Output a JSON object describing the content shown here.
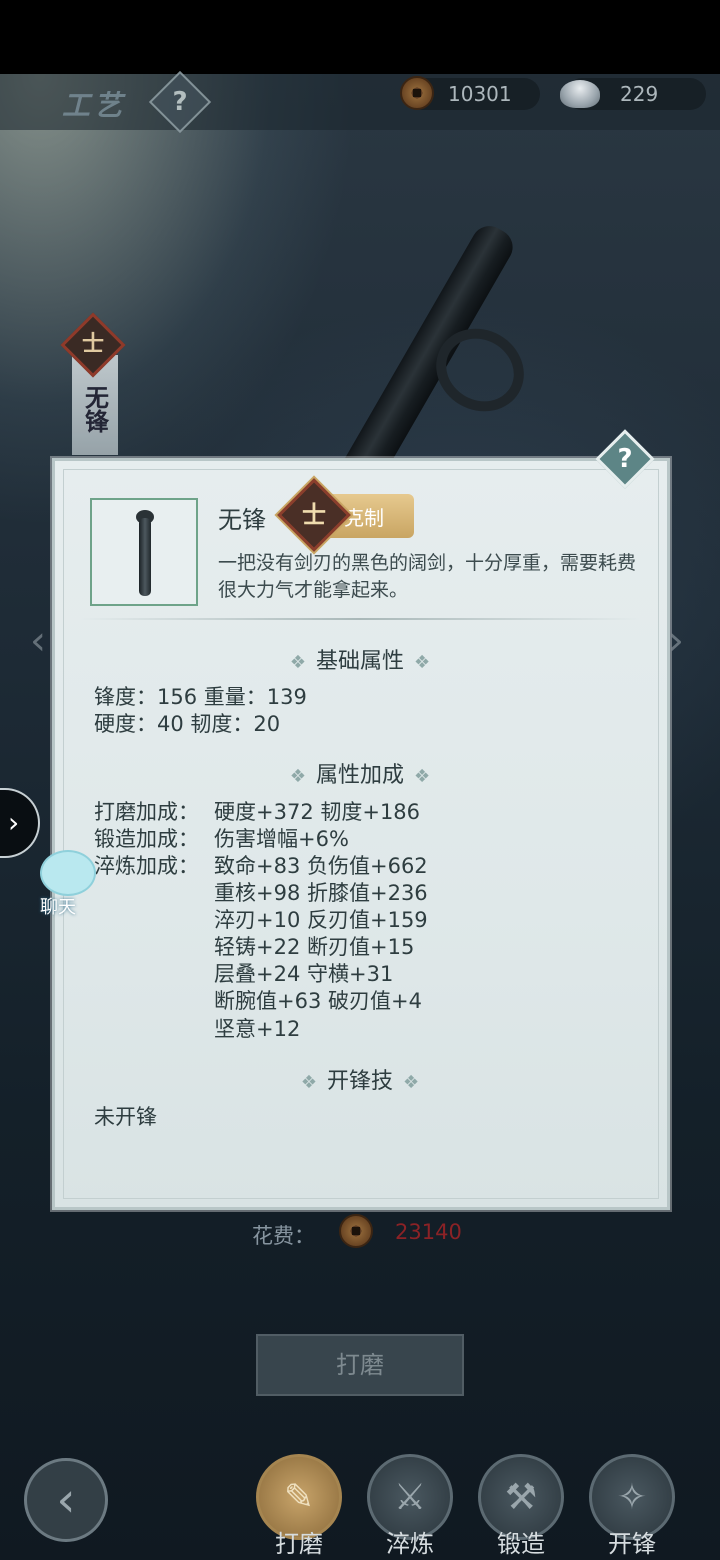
{
  "header": {
    "title": "工艺",
    "help_symbol": "?",
    "copper_amount": "10301",
    "silver_amount": "229"
  },
  "side_tag": {
    "label": "无锋",
    "emblem": "士"
  },
  "item": {
    "name": "无锋",
    "emblem": "士",
    "counter_label": "克制",
    "description": "一把没有剑刃的黑色的阔剑，十分厚重，需要耗费很大力气才能拿起来。"
  },
  "base_attrs": {
    "title": "基础属性",
    "line1": "锋度：156  重量：139",
    "line2": "硬度：40  韧度：20"
  },
  "bonus_attrs": {
    "title": "属性加成",
    "polish_label": "打磨加成：",
    "polish_value": "硬度+372  韧度+186",
    "forge_label": "锻造加成：",
    "forge_value": "伤害增幅+6%",
    "temper_label": "淬炼加成：",
    "temper_lines": [
      "致命+83  负伤值+662",
      "重核+98  折膝值+236",
      "淬刃+10  反刃值+159",
      "轻铸+22  断刃值+15",
      "层叠+24  守横+31",
      "断腕值+63  破刃值+4",
      "坚意+12"
    ]
  },
  "skill": {
    "title": "开锋技",
    "value": "未开锋"
  },
  "cost": {
    "label": "花费：",
    "value": "23140"
  },
  "action": {
    "label": "打磨"
  },
  "chat": {
    "label": "聊天"
  },
  "tabs": [
    {
      "label": "打磨",
      "icon": "hammer-icon",
      "glyph": "✎"
    },
    {
      "label": "淬炼",
      "icon": "sword-icon",
      "glyph": "⚔"
    },
    {
      "label": "锻造",
      "icon": "anvil-icon",
      "glyph": "⚒"
    },
    {
      "label": "开锋",
      "icon": "shuriken-icon",
      "glyph": "✧"
    }
  ],
  "colors": {
    "cost_value": "#8b2226",
    "counter_badge": "#c9a563",
    "panel_bg": "#e3eaeb"
  }
}
